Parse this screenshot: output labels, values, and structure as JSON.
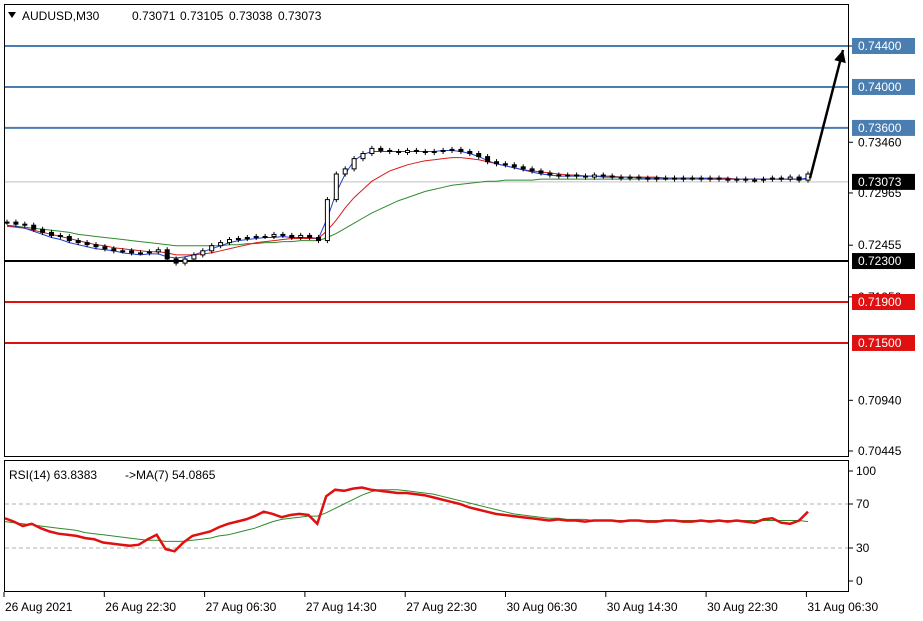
{
  "header": {
    "symbol": "AUDUSD,M30",
    "open": "0.73071",
    "high": "0.73105",
    "low": "0.73038",
    "close": "0.73073"
  },
  "rsi_header": {
    "label": "RSI(14) 63.8383",
    "ma_label": "->MA(7) 54.0865"
  },
  "colors": {
    "candle": "#000000",
    "ma_fast": "#1f3fd6",
    "ma_mid": "#d81b1b",
    "ma_slow": "#2e8b2e",
    "resistance": "#4a7eb0",
    "support": "#e01010",
    "pivot": "#000000",
    "rsi": "#e01010",
    "rsi_ma": "#2e8b2e",
    "arrow": "#000000"
  },
  "chart_data": [
    {
      "type": "candlestick",
      "title": "AUDUSD,M30",
      "price_ticks": [
        "0.74400",
        "0.73460",
        "0.72965",
        "0.72455",
        "0.71950",
        "0.70940",
        "0.70445"
      ],
      "time_ticks": [
        "26 Aug 2021",
        "26 Aug 22:30",
        "27 Aug 06:30",
        "27 Aug 14:30",
        "27 Aug 22:30",
        "30 Aug 06:30",
        "30 Aug 14:30",
        "30 Aug 22:30",
        "31 Aug 06:30"
      ],
      "ylim": [
        0.70445,
        0.744
      ],
      "current_price": "0.73073",
      "levels": [
        {
          "price": 0.744,
          "label": "0.74400",
          "kind": "resistance"
        },
        {
          "price": 0.74,
          "label": "0.74000",
          "kind": "resistance"
        },
        {
          "price": 0.736,
          "label": "0.73600",
          "kind": "resistance"
        },
        {
          "price": 0.723,
          "label": "0.72300",
          "kind": "pivot"
        },
        {
          "price": 0.719,
          "label": "0.71900",
          "kind": "support"
        },
        {
          "price": 0.715,
          "label": "0.71500",
          "kind": "support"
        }
      ],
      "close_series": [
        0.7268,
        0.7266,
        0.7265,
        0.7261,
        0.7258,
        0.7255,
        0.7254,
        0.725,
        0.7248,
        0.7246,
        0.7244,
        0.7242,
        0.724,
        0.724,
        0.7238,
        0.7238,
        0.7239,
        0.7241,
        0.7232,
        0.7228,
        0.7232,
        0.7236,
        0.724,
        0.7245,
        0.7248,
        0.7251,
        0.7252,
        0.7253,
        0.7254,
        0.7254,
        0.7256,
        0.7255,
        0.7253,
        0.7255,
        0.7253,
        0.725,
        0.729,
        0.7315,
        0.732,
        0.733,
        0.7335,
        0.734,
        0.7338,
        0.7337,
        0.7336,
        0.7338,
        0.7337,
        0.7336,
        0.7337,
        0.7338,
        0.7339,
        0.7337,
        0.7335,
        0.7332,
        0.7327,
        0.7325,
        0.7324,
        0.7322,
        0.732,
        0.7318,
        0.7316,
        0.7314,
        0.7313,
        0.7314,
        0.7313,
        0.7312,
        0.7314,
        0.7313,
        0.7312,
        0.7311,
        0.7312,
        0.7311,
        0.731,
        0.7311,
        0.7311,
        0.731,
        0.7311,
        0.7311,
        0.731,
        0.7311,
        0.731,
        0.7309,
        0.731,
        0.7309,
        0.7309,
        0.731,
        0.7311,
        0.731,
        0.7312,
        0.7309,
        0.7315
      ],
      "ma_fast": [
        0.7265,
        0.7264,
        0.7262,
        0.7259,
        0.7256,
        0.7253,
        0.7251,
        0.7248,
        0.7246,
        0.7244,
        0.7242,
        0.7241,
        0.724,
        0.7238,
        0.7237,
        0.7236,
        0.7237,
        0.7237,
        0.7234,
        0.7233,
        0.7234,
        0.7236,
        0.7239,
        0.7242,
        0.7245,
        0.7248,
        0.725,
        0.7251,
        0.7252,
        0.7253,
        0.7253,
        0.7254,
        0.7253,
        0.7253,
        0.7253,
        0.7252,
        0.7272,
        0.7297,
        0.7315,
        0.7328,
        0.7334,
        0.7337,
        0.7337,
        0.7337,
        0.7337,
        0.7337,
        0.7337,
        0.7337,
        0.7337,
        0.7338,
        0.7338,
        0.7337,
        0.7335,
        0.7332,
        0.7328,
        0.7325,
        0.7323,
        0.7321,
        0.7319,
        0.7317,
        0.7315,
        0.7314,
        0.7313,
        0.7313,
        0.7313,
        0.7313,
        0.7313,
        0.7312,
        0.7312,
        0.7312,
        0.7312,
        0.7311,
        0.7311,
        0.7311,
        0.7311,
        0.7311,
        0.7311,
        0.7311,
        0.7311,
        0.731,
        0.731,
        0.731,
        0.731,
        0.731,
        0.731,
        0.731,
        0.731,
        0.731,
        0.731,
        0.731,
        0.7311
      ],
      "ma_mid": [
        0.7264,
        0.7263,
        0.7262,
        0.726,
        0.7258,
        0.7256,
        0.7254,
        0.7252,
        0.725,
        0.7248,
        0.7246,
        0.7245,
        0.7243,
        0.7242,
        0.7241,
        0.724,
        0.7239,
        0.7239,
        0.7238,
        0.7236,
        0.7236,
        0.7236,
        0.7237,
        0.7238,
        0.724,
        0.7242,
        0.7244,
        0.7246,
        0.7248,
        0.7249,
        0.725,
        0.7251,
        0.7252,
        0.7252,
        0.7252,
        0.7252,
        0.726,
        0.727,
        0.7282,
        0.7292,
        0.73,
        0.7308,
        0.7313,
        0.7318,
        0.7321,
        0.7324,
        0.7326,
        0.7328,
        0.7329,
        0.733,
        0.7331,
        0.7331,
        0.733,
        0.7329,
        0.7327,
        0.7325,
        0.7323,
        0.7321,
        0.7319,
        0.7318,
        0.7317,
        0.7316,
        0.7315,
        0.7314,
        0.7314,
        0.7313,
        0.7313,
        0.7313,
        0.7313,
        0.7312,
        0.7312,
        0.7312,
        0.7312,
        0.7312,
        0.7311,
        0.7311,
        0.7311,
        0.7311,
        0.7311,
        0.7311,
        0.7311,
        0.7311,
        0.731,
        0.731,
        0.731,
        0.731,
        0.731,
        0.731,
        0.731,
        0.731,
        0.731
      ],
      "ma_slow": [
        0.7264,
        0.7264,
        0.7263,
        0.7262,
        0.7261,
        0.726,
        0.7259,
        0.7258,
        0.7256,
        0.7255,
        0.7254,
        0.7253,
        0.7252,
        0.7251,
        0.725,
        0.7249,
        0.7248,
        0.7247,
        0.7246,
        0.7245,
        0.7245,
        0.7245,
        0.7245,
        0.7245,
        0.7245,
        0.7246,
        0.7246,
        0.7247,
        0.7247,
        0.7248,
        0.7248,
        0.7249,
        0.7249,
        0.725,
        0.725,
        0.725,
        0.7253,
        0.7257,
        0.7262,
        0.7267,
        0.7272,
        0.7277,
        0.7281,
        0.7285,
        0.7289,
        0.7292,
        0.7295,
        0.7298,
        0.73,
        0.7302,
        0.7304,
        0.7305,
        0.7306,
        0.7307,
        0.7308,
        0.7308,
        0.7309,
        0.7309,
        0.7309,
        0.7309,
        0.731,
        0.731,
        0.731,
        0.731,
        0.731,
        0.731,
        0.731,
        0.731,
        0.731,
        0.731,
        0.731,
        0.731,
        0.731,
        0.731,
        0.731,
        0.731,
        0.731,
        0.731,
        0.731,
        0.731,
        0.731,
        0.731,
        0.731,
        0.731,
        0.731,
        0.731,
        0.731,
        0.731,
        0.731,
        0.731,
        0.731
      ],
      "forecast_arrow": {
        "from_price": 0.7308,
        "to_price": 0.744
      }
    },
    {
      "type": "line",
      "title": "RSI(14)",
      "ylim": [
        0,
        100
      ],
      "y_ticks": [
        "100",
        "70",
        "30",
        "0"
      ],
      "levels": [
        70,
        30
      ],
      "series": [
        {
          "name": "RSI(14)",
          "values": [
            57,
            54,
            50,
            52,
            48,
            45,
            43,
            42,
            41,
            39,
            38,
            35,
            34,
            33,
            32,
            33,
            38,
            42,
            29,
            27,
            35,
            41,
            43,
            45,
            49,
            52,
            54,
            56,
            59,
            63,
            61,
            58,
            60,
            61,
            60,
            52,
            77,
            83,
            82,
            84,
            85,
            83,
            82,
            81,
            80,
            80,
            79,
            78,
            76,
            74,
            72,
            70,
            67,
            65,
            63,
            61,
            60,
            59,
            58,
            57,
            56,
            55,
            56,
            55,
            55,
            54,
            55,
            55,
            55,
            54,
            55,
            55,
            54,
            54,
            55,
            55,
            54,
            54,
            55,
            54,
            55,
            54,
            55,
            54,
            53,
            56,
            57,
            53,
            52,
            55,
            63
          ]
        },
        {
          "name": "MA(7)",
          "values": [
            54,
            53,
            52,
            51,
            50,
            49,
            48,
            47,
            46,
            44,
            43,
            42,
            41,
            40,
            39,
            38,
            37,
            37,
            36,
            36,
            36,
            37,
            38,
            39,
            41,
            42,
            44,
            46,
            48,
            51,
            54,
            56,
            57,
            58,
            59,
            59,
            62,
            66,
            70,
            74,
            78,
            81,
            83,
            83,
            83,
            82,
            81,
            80,
            79,
            77,
            75,
            73,
            71,
            69,
            67,
            65,
            63,
            61,
            60,
            59,
            58,
            57,
            57,
            56,
            56,
            56,
            55,
            55,
            55,
            55,
            55,
            55,
            55,
            55,
            55,
            55,
            55,
            55,
            55,
            55,
            55,
            55,
            55,
            55,
            55,
            55,
            55,
            55,
            55,
            55,
            54
          ]
        }
      ]
    }
  ]
}
